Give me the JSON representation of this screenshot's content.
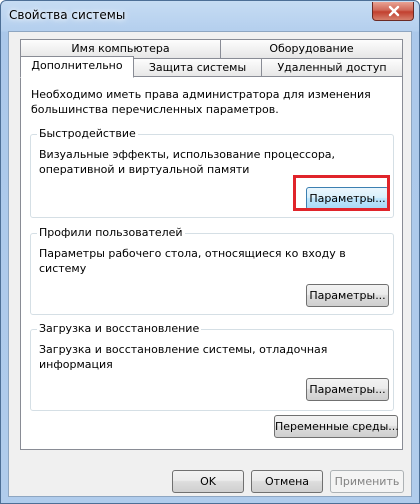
{
  "window": {
    "title": "Свойства системы"
  },
  "tabs": {
    "row1": [
      "Имя компьютера",
      "Оборудование"
    ],
    "row2": [
      "Дополнительно",
      "Защита системы",
      "Удаленный доступ"
    ],
    "active": "Дополнительно"
  },
  "panel": {
    "note": "Необходимо иметь права администратора для изменения большинства перечисленных параметров.",
    "performance": {
      "title": "Быстродействие",
      "description": "Визуальные эффекты, использование процессора, оперативной и виртуальной памяти",
      "button": "Параметры..."
    },
    "profiles": {
      "title": "Профили пользователей",
      "description": "Параметры рабочего стола, относящиеся ко входу в систему",
      "button": "Параметры..."
    },
    "startup": {
      "title": "Загрузка и восстановление",
      "description": "Загрузка и восстановление системы, отладочная информация",
      "button": "Параметры..."
    },
    "env_button": "Переменные среды..."
  },
  "footer": {
    "ok": "OK",
    "cancel": "Отмена",
    "apply": "Применить"
  },
  "colors": {
    "highlight": "#e0242a",
    "close_button": "#c2402f"
  }
}
